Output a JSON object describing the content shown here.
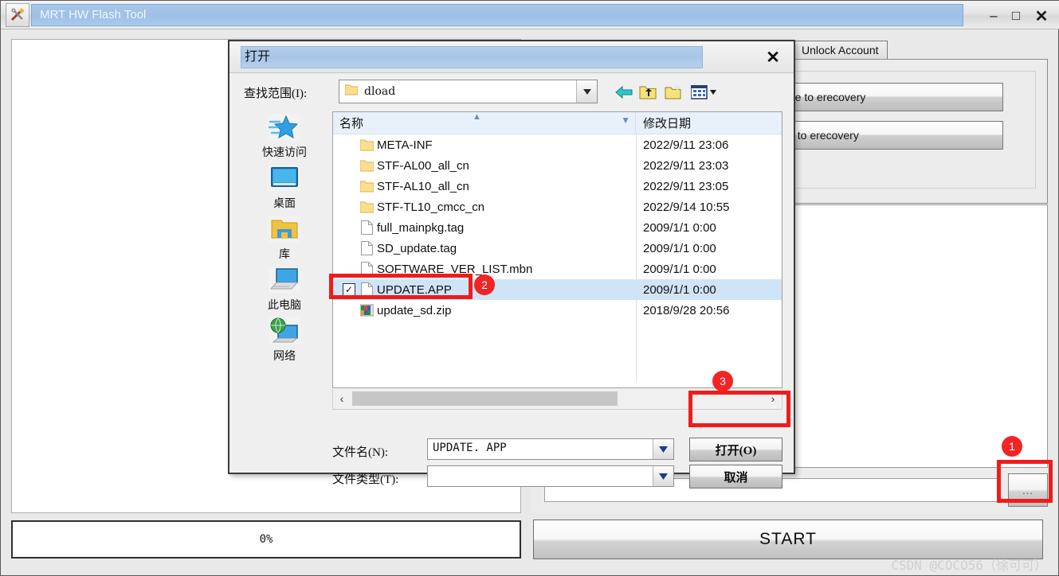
{
  "app": {
    "title": "MRT HW Flash Tool",
    "icon": "tools-icon",
    "window_buttons": {
      "minimize": "–",
      "maximize": "□",
      "close": "✕"
    },
    "progress": {
      "value": "0%"
    },
    "start_label": "START",
    "browse_label": "...",
    "tabs": [
      {
        "label": "Unlock Account"
      }
    ],
    "action_buttons": [
      {
        "label": "Production mode to erecovery"
      },
      {
        "label": "fastboot mode to erecovery"
      }
    ]
  },
  "dialog": {
    "title": "打开",
    "close_label": "✕",
    "lookin_label": "查找范围(I):",
    "lookin_value": "dload",
    "toolbar": [
      {
        "name": "back-icon"
      },
      {
        "name": "up-folder-icon"
      },
      {
        "name": "new-folder-icon"
      },
      {
        "name": "views-icon"
      }
    ],
    "places": [
      {
        "label": "快速访问",
        "icon": "quick-access-star-icon"
      },
      {
        "label": "桌面",
        "icon": "desktop-monitor-icon"
      },
      {
        "label": "库",
        "icon": "libraries-folder-icon"
      },
      {
        "label": "此电脑",
        "icon": "this-pc-icon"
      },
      {
        "label": "网络",
        "icon": "network-globe-icon"
      }
    ],
    "columns": {
      "name": "名称",
      "date": "修改日期"
    },
    "files": [
      {
        "name": "META-INF",
        "date": "2022/9/11 23:06",
        "type": "folder",
        "selected": false,
        "checked": false
      },
      {
        "name": "STF-AL00_all_cn",
        "date": "2022/9/11 23:03",
        "type": "folder",
        "selected": false,
        "checked": false
      },
      {
        "name": "STF-AL10_all_cn",
        "date": "2022/9/11 23:05",
        "type": "folder",
        "selected": false,
        "checked": false
      },
      {
        "name": "STF-TL10_cmcc_cn",
        "date": "2022/9/14 10:55",
        "type": "folder",
        "selected": false,
        "checked": false
      },
      {
        "name": "full_mainpkg.tag",
        "date": "2009/1/1 0:00",
        "type": "file",
        "selected": false,
        "checked": false
      },
      {
        "name": "SD_update.tag",
        "date": "2009/1/1 0:00",
        "type": "file",
        "selected": false,
        "checked": false
      },
      {
        "name": "SOFTWARE_VER_LIST.mbn",
        "date": "2009/1/1 0:00",
        "type": "file",
        "selected": false,
        "checked": false
      },
      {
        "name": "UPDATE.APP",
        "date": "2009/1/1 0:00",
        "type": "file",
        "selected": true,
        "checked": true
      },
      {
        "name": "update_sd.zip",
        "date": "2018/9/28 20:56",
        "type": "archive",
        "selected": false,
        "checked": false
      }
    ],
    "filename_label": "文件名(N):",
    "filename_value": "UPDATE. APP",
    "filetype_label": "文件类型(T):",
    "filetype_value": "",
    "open_label": "打开(O)",
    "cancel_label": "取消"
  },
  "annotations": [
    {
      "id": "1",
      "target": "browse-button"
    },
    {
      "id": "2",
      "target": "update-app-row"
    },
    {
      "id": "3",
      "target": "open-button"
    }
  ],
  "watermark": "CSDN @COCO56（徐可可）",
  "colors": {
    "accent_red": "#f22424",
    "title_blue": "#a8c8ea",
    "selection_blue": "#cfe4f7"
  }
}
